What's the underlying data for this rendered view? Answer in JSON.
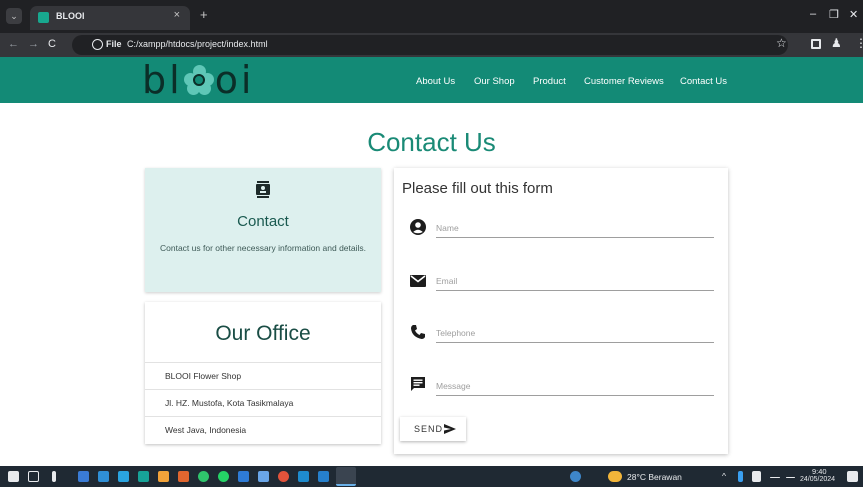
{
  "browser": {
    "tab_title": "BLOOI",
    "tab_close": "×",
    "new_tab": "+",
    "menu_glyph": "⌄",
    "window_min": "–",
    "window_max": "❐",
    "window_close": "✕",
    "nav_back": "←",
    "nav_forward": "→",
    "nav_reload": "C",
    "url_scheme_chip": "File",
    "url": "C:/xampp/htdocs/project/index.html",
    "star_glyph": "☆",
    "profile_glyph": "♟",
    "kebab_glyph": "⋮"
  },
  "site": {
    "logo_left": "bl",
    "logo_right": "oi",
    "nav": [
      "About Us",
      "Our Shop",
      "Product",
      "Customer Reviews",
      "Contact Us"
    ]
  },
  "page": {
    "title": "Contact Us"
  },
  "contact_card": {
    "heading": "Contact",
    "description": "Contact us for other necessary information and details."
  },
  "office_card": {
    "heading": "Our Office",
    "rows": [
      "BLOOI Flower Shop",
      "Jl. HZ. Mustofa, Kota Tasikmalaya",
      "West Java, Indonesia"
    ]
  },
  "form": {
    "title": "Please fill out this form",
    "fields": [
      {
        "placeholder": "Name",
        "value": ""
      },
      {
        "placeholder": "Email",
        "value": ""
      },
      {
        "placeholder": "Telephone",
        "value": ""
      },
      {
        "placeholder": "Message",
        "value": ""
      }
    ],
    "send_label": "SEND"
  },
  "taskbar": {
    "weather": "28°C  Berawan",
    "time": "9:40",
    "date": "24/05/2024"
  },
  "colors": {
    "brand": "#138a76",
    "accent_light": "#ddf0ee",
    "title": "#1a8a76"
  },
  "icons": [
    "contact-card-icon",
    "user-circle-icon",
    "mail-icon",
    "phone-icon",
    "message-icon",
    "send-arrow-icon"
  ]
}
